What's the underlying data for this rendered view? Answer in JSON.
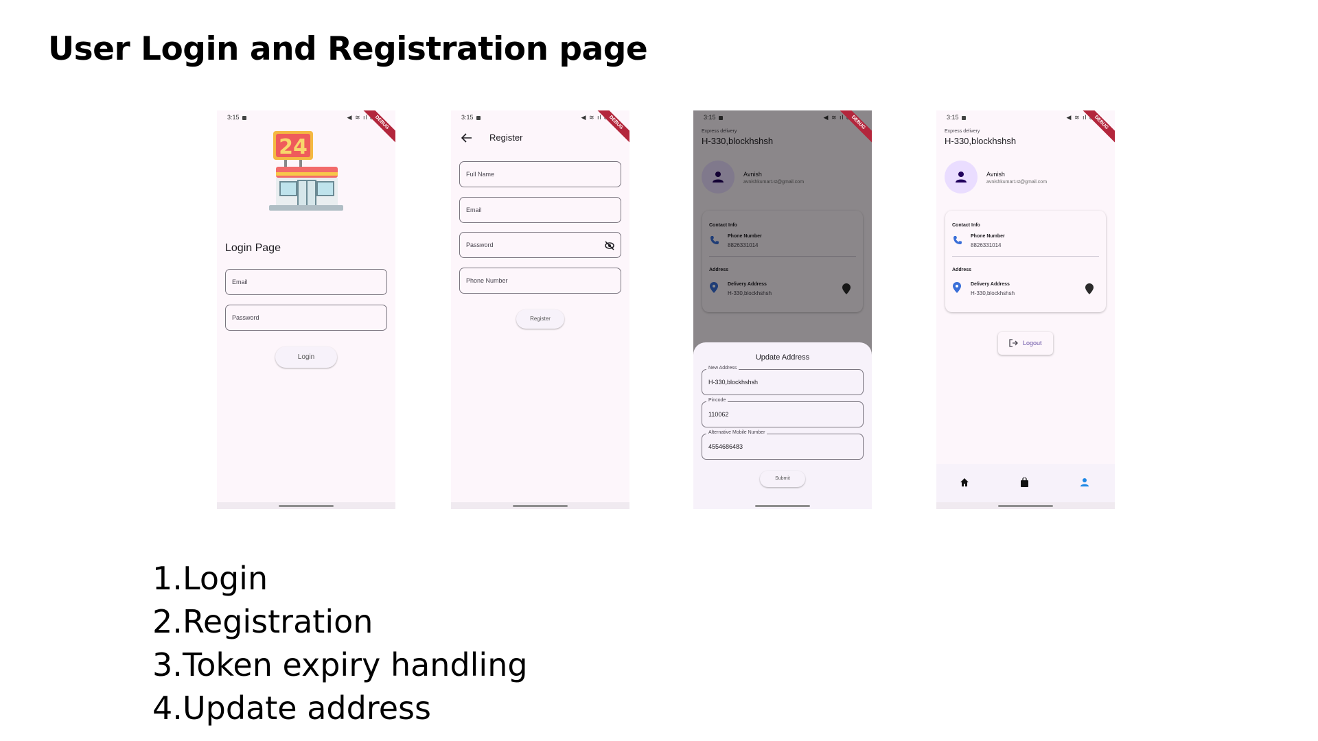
{
  "slide": {
    "title": "User Login and Registration page",
    "features": [
      {
        "num": "1.",
        "text": "Login"
      },
      {
        "num": "2.",
        "text": "Registration"
      },
      {
        "num": "3.",
        "text": "Token expiry handling"
      },
      {
        "num": "4.",
        "text": "Update address"
      }
    ]
  },
  "status_bar": {
    "time": "3:15",
    "indicators": "◀ ≋ ıl 83",
    "debug_banner": "DEBUG"
  },
  "login_screen": {
    "logo_icon": "convenience-store-24-icon",
    "heading": "Login Page",
    "email_label": "Email",
    "password_label": "Password",
    "login_button": "Login"
  },
  "register_screen": {
    "title": "Register",
    "full_name_label": "Full Name",
    "email_label": "Email",
    "password_label": "Password",
    "phone_label": "Phone Number",
    "register_button": "Register"
  },
  "profile": {
    "express_label": "Express delivery",
    "address_header": "H-330,blockhshsh",
    "user_name": "Avnish",
    "user_email": "avnishkumar1st@gmail.com",
    "contact_info_label": "Contact Info",
    "phone_title": "Phone Number",
    "phone_value": "8826331014",
    "address_label": "Address",
    "delivery_title": "Delivery Address",
    "delivery_value": "H-330,blockhshsh",
    "logout_button": "Logout"
  },
  "update_sheet": {
    "title": "Update Address",
    "new_address_label": "New Address",
    "new_address_value": "H-330,blockhshsh",
    "pincode_label": "Pincode",
    "pincode_value": "110062",
    "alt_mobile_label": "Alternative Mobile Number",
    "alt_mobile_value": "4554686483",
    "submit_button": "Submit"
  },
  "nav": {
    "items": [
      "home-icon",
      "shopping-bag-icon",
      "person-icon"
    ],
    "active_color": "#1e88e5"
  }
}
